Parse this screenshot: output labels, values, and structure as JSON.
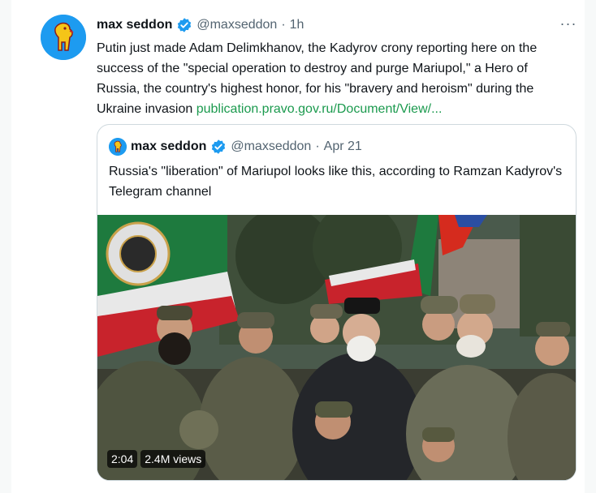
{
  "tweet": {
    "author_name": "max seddon",
    "handle": "@maxseddon",
    "separator": "·",
    "time": "1h",
    "more_icon": "more-dots-icon",
    "text": "Putin just made Adam Delimkhanov, the Kadyrov crony reporting here on the success of the \"special operation to destroy and purge Mariupol,\" a Hero of Russia, the country's highest honor, for his \"bravery and heroism\" during the Ukraine invasion ",
    "link": "publication.pravo.gov.ru/Document/View/..."
  },
  "quote": {
    "author_name": "max seddon",
    "handle": "@maxseddon",
    "separator": "·",
    "date": "Apr 21",
    "text": "Russia's \"liberation\" of Mariupol looks like this, according to Ramzan Kadyrov's Telegram channel",
    "video": {
      "duration": "2:04",
      "views": "2.4M views"
    }
  },
  "colors": {
    "verified": "#1d9bf0",
    "link": "#1b9a4e",
    "secondary_text": "#536471"
  }
}
